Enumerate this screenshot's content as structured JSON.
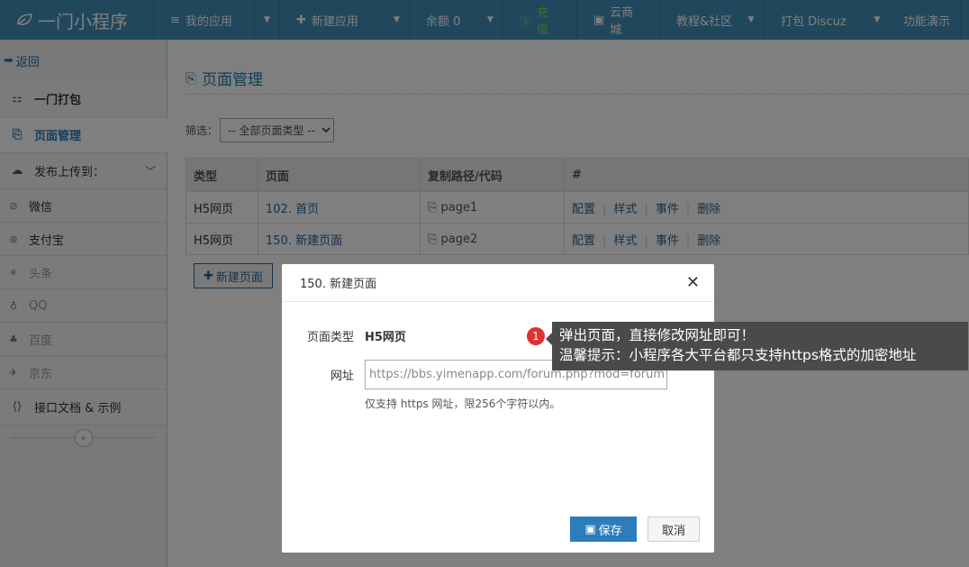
{
  "topnav": {
    "brand": "一门小程序",
    "items": [
      {
        "label": "我的应用",
        "icon": "list-icon"
      },
      {
        "label": "新建应用",
        "icon": "plus-icon"
      },
      {
        "label": "余额 0"
      },
      {
        "label": "充值",
        "icon": "yen-icon"
      },
      {
        "label": "云商城",
        "icon": "store-icon"
      },
      {
        "label": "教程&社区"
      },
      {
        "label": "打包 Discuz"
      },
      {
        "label": "功能演示"
      }
    ]
  },
  "sidebar": {
    "back": "返回",
    "items": [
      {
        "label": "一门打包"
      },
      {
        "label": "页面管理"
      },
      {
        "label": "发布上传到："
      },
      {
        "label": "微信"
      },
      {
        "label": "支付宝"
      },
      {
        "label": "头条"
      },
      {
        "label": "QQ"
      },
      {
        "label": "百度"
      },
      {
        "label": "京东"
      },
      {
        "label": "接口文档 & 示例"
      }
    ]
  },
  "main": {
    "title": "页面管理",
    "filter_label": "筛选：",
    "filter_value": "-- 全部页面类型 --",
    "table": {
      "headers": [
        "类型",
        "页面",
        "复制路径/代码",
        "#"
      ],
      "rows": [
        {
          "type": "H5网页",
          "page": "102. 首页",
          "path": "page1"
        },
        {
          "type": "H5网页",
          "page": "150. 新建页面",
          "path": "page2"
        }
      ],
      "actions": [
        "配置",
        "样式",
        "事件",
        "删除"
      ]
    },
    "add_button": "新建页面"
  },
  "modal": {
    "title": "150. 新建页面",
    "type_label": "页面类型",
    "type_value": "H5网页",
    "url_label": "网址",
    "url_value": "https://bbs.yimenapp.com/forum.php?mod=forum",
    "hint": "仅支持 https 网址，限256个字符以内。",
    "save": "保存",
    "cancel": "取消"
  },
  "tooltip": {
    "badge": "1",
    "line1": "弹出页面，直接修改网址即可！",
    "line2": "温馨提示：小程序各大平台都只支持https格式的加密地址"
  }
}
